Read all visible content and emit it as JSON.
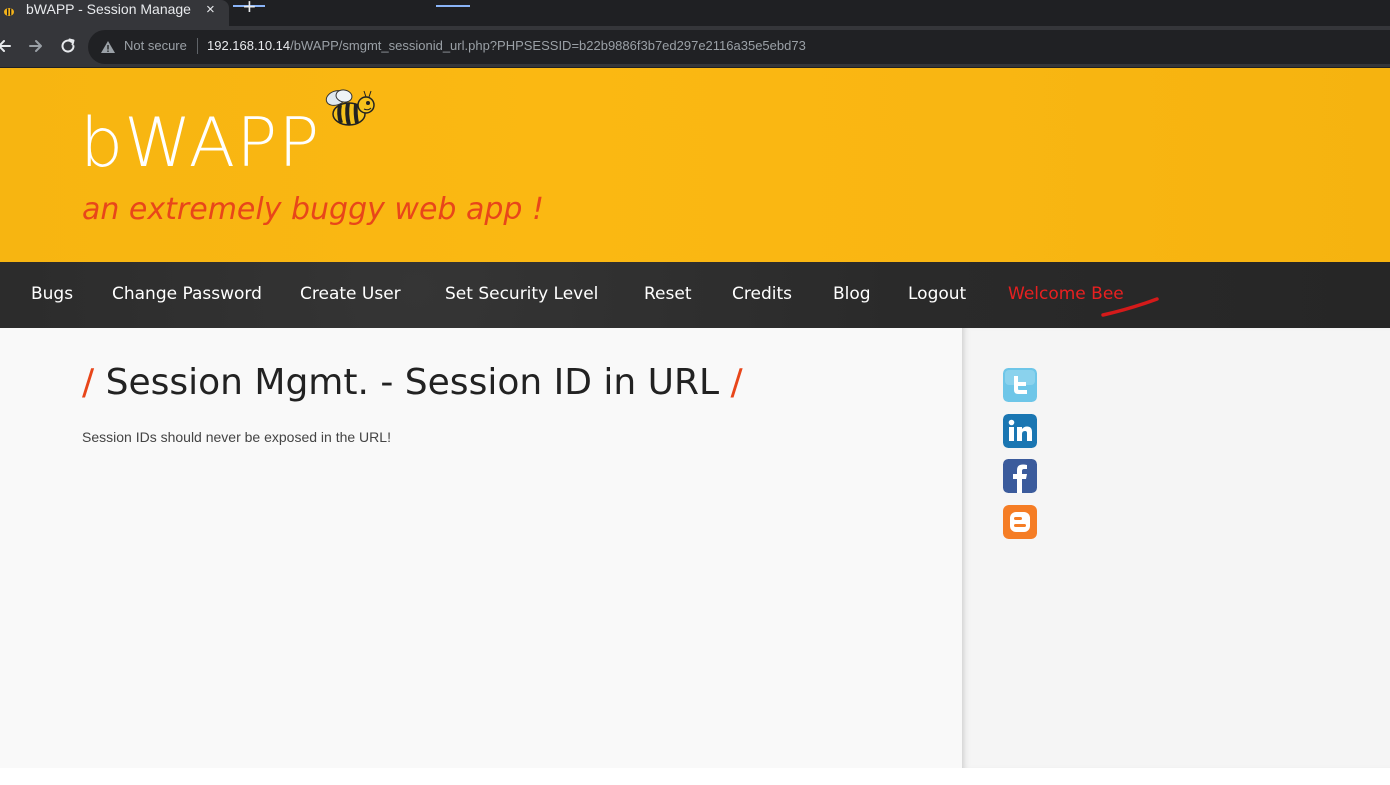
{
  "browser": {
    "tab_title": "bWAPP - Session Manage",
    "tab_close": "×",
    "new_tab": "+",
    "not_secure": "Not secure",
    "url_host": "192.168.10.14",
    "url_path": "/bWAPP/smgmt_sessionid_url.php?PHPSESSID=b22b9886f3b7ed297e2116a35e5ebd73"
  },
  "header": {
    "logo": "bWAPP",
    "tagline": "an extremely buggy web app !"
  },
  "nav": {
    "items": [
      "Bugs",
      "Change Password",
      "Create User",
      "Set Security Level",
      "Reset",
      "Credits",
      "Blog",
      "Logout"
    ],
    "welcome": "Welcome Bee"
  },
  "main": {
    "title_slash_left": "/",
    "title": "Session Mgmt. - Session ID in URL",
    "title_slash_right": "/",
    "description": "Session IDs should never be exposed in the URL!"
  },
  "sidebar": {
    "social_icons": [
      "twitter-icon",
      "linkedin-icon",
      "facebook-icon",
      "blogger-icon"
    ]
  },
  "colors": {
    "header_yellow": "#fbb812",
    "accent_orange": "#e8461a",
    "nav_dark": "#2b2b2b",
    "welcome_red": "#e82020"
  }
}
